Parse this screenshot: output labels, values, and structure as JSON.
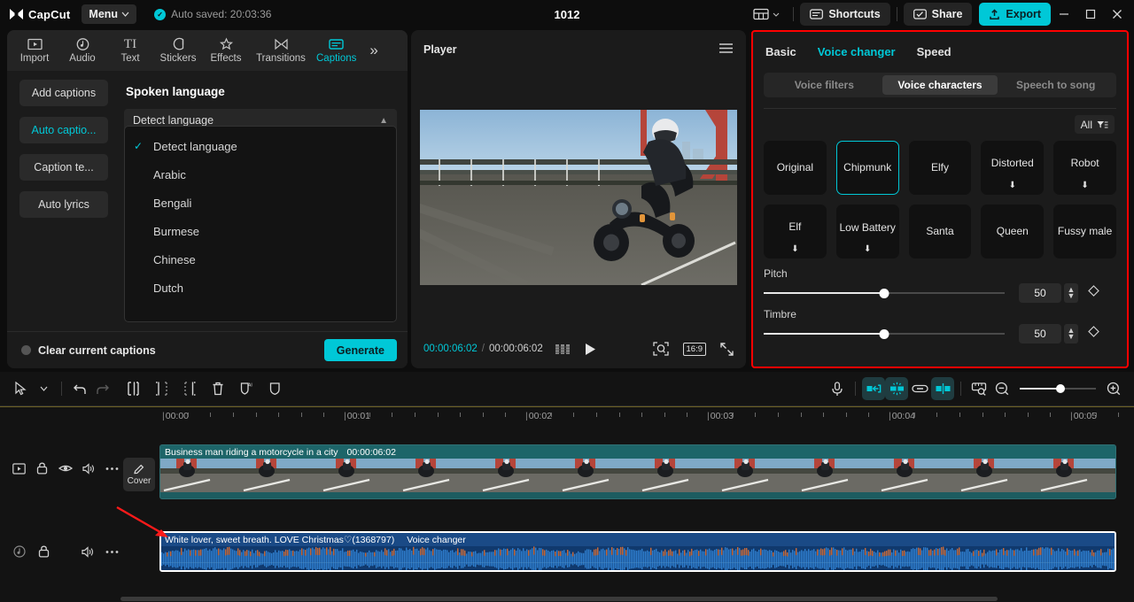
{
  "titlebar": {
    "brand": "CapCut",
    "menu_label": "Menu",
    "autosave_text": "Auto saved: 20:03:36",
    "project_title": "1012",
    "layout_icon": "layout-icon",
    "shortcuts_label": "Shortcuts",
    "share_label": "Share",
    "export_label": "Export",
    "minimize": "–",
    "maximize": "□",
    "close": "✕",
    "accent": "#00c8d7"
  },
  "left_panel": {
    "nav_tabs": [
      {
        "label": "Import",
        "icon": "import-icon"
      },
      {
        "label": "Audio",
        "icon": "audio-note-icon"
      },
      {
        "label": "Text",
        "icon": "text-ti-icon"
      },
      {
        "label": "Stickers",
        "icon": "sticker-icon"
      },
      {
        "label": "Effects",
        "icon": "effects-sparkle-icon"
      },
      {
        "label": "Transitions",
        "icon": "transitions-icon"
      },
      {
        "label": "Captions",
        "icon": "captions-icon"
      }
    ],
    "active_tab": "Captions",
    "expand_icon": "chevron-double-right-icon",
    "sub_items": [
      {
        "label": "Add captions",
        "active": false
      },
      {
        "label": "Auto captio...",
        "active": true
      },
      {
        "label": "Caption te...",
        "active": false
      },
      {
        "label": "Auto lyrics",
        "active": false
      }
    ],
    "section_title": "Spoken language",
    "select_value": "Detect language",
    "dropdown_options": [
      {
        "label": "Detect language",
        "checked": true
      },
      {
        "label": "Arabic",
        "checked": false
      },
      {
        "label": "Bengali",
        "checked": false
      },
      {
        "label": "Burmese",
        "checked": false
      },
      {
        "label": "Chinese",
        "checked": false
      },
      {
        "label": "Dutch",
        "checked": false
      }
    ],
    "footer_toggle_label": "Clear current captions",
    "generate_label": "Generate"
  },
  "player": {
    "title": "Player",
    "menu_icon": "hamburger-icon",
    "current_time": "00:00:06:02",
    "time_separator": "/",
    "total_time": "00:00:06:02",
    "frames_icon": "frames-icon",
    "play_icon": "play-icon",
    "zoom_fit_icon": "magnifier-frame-icon",
    "ratio_label": "16:9",
    "fullscreen_icon": "fullscreen-icon"
  },
  "right_panel": {
    "tabs": [
      {
        "label": "Basic",
        "active": false
      },
      {
        "label": "Voice changer",
        "active": true
      },
      {
        "label": "Speed",
        "active": false
      }
    ],
    "segments": [
      {
        "label": "Voice filters",
        "active": false
      },
      {
        "label": "Voice characters",
        "active": true
      },
      {
        "label": "Speech to song",
        "active": false
      }
    ],
    "filter_label": "All",
    "filter_icon": "filter-icon",
    "voice_characters": [
      {
        "label": "Original",
        "selected": false,
        "download": false
      },
      {
        "label": "Chipmunk",
        "selected": true,
        "download": false
      },
      {
        "label": "Elfy",
        "selected": false,
        "download": false
      },
      {
        "label": "Distorted",
        "selected": false,
        "download": true
      },
      {
        "label": "Robot",
        "selected": false,
        "download": true
      },
      {
        "label": "Elf",
        "selected": false,
        "download": true
      },
      {
        "label": "Low Battery",
        "selected": false,
        "download": true
      },
      {
        "label": "Santa",
        "selected": false,
        "download": false
      },
      {
        "label": "Queen",
        "selected": false,
        "download": false
      },
      {
        "label": "Fussy male",
        "selected": false,
        "download": false
      }
    ],
    "sliders": [
      {
        "label": "Pitch",
        "value": "50",
        "percent": 50
      },
      {
        "label": "Timbre",
        "value": "50",
        "percent": 50
      }
    ],
    "keyframe_icon": "keyframe-diamond-icon",
    "highlight_color": "#ff0000"
  },
  "timeline": {
    "tools_left": [
      {
        "name": "select-cursor-icon",
        "enabled": true
      },
      {
        "name": "cursor-dropdown-icon",
        "enabled": true
      },
      {
        "name": "undo-icon",
        "enabled": true
      },
      {
        "name": "redo-icon",
        "enabled": false
      },
      {
        "name": "split-icon",
        "enabled": true
      },
      {
        "name": "trim-left-icon",
        "enabled": true
      },
      {
        "name": "trim-right-icon",
        "enabled": true
      },
      {
        "name": "delete-icon",
        "enabled": true
      },
      {
        "name": "ai-mask-icon",
        "enabled": true
      },
      {
        "name": "mask-icon",
        "enabled": true
      }
    ],
    "tools_right": [
      {
        "name": "microphone-icon",
        "active": false
      },
      {
        "name": "auto-fit-icon",
        "active": true
      },
      {
        "name": "auto-cutout-icon",
        "active": true
      },
      {
        "name": "link-icon",
        "active": false
      },
      {
        "name": "snap-icon",
        "active": true
      },
      {
        "name": "adjust-ruler-icon",
        "active": false
      },
      {
        "name": "zoom-out-icon",
        "active": false
      },
      {
        "name": "zoom-in-icon",
        "active": false
      }
    ],
    "ruler_ticks": [
      "00:00",
      "00:01",
      "00:02",
      "00:03",
      "00:04",
      "00:05"
    ],
    "video_track": {
      "name": "Business man riding a motorcycle in a city",
      "duration": "00:00:06:02",
      "cover_label": "Cover",
      "cover_icon": "pencil-icon",
      "head_icons": [
        "video-track-icon",
        "lock-icon",
        "eye-icon",
        "speaker-icon",
        "more-icon"
      ]
    },
    "audio_track": {
      "name": "White lover, sweet breath. LOVE Christmas♡(1368797)",
      "effect_badge": "Voice changer",
      "head_icons": [
        "audio-track-icon",
        "lock-icon",
        "speaker-icon",
        "more-icon"
      ]
    }
  }
}
